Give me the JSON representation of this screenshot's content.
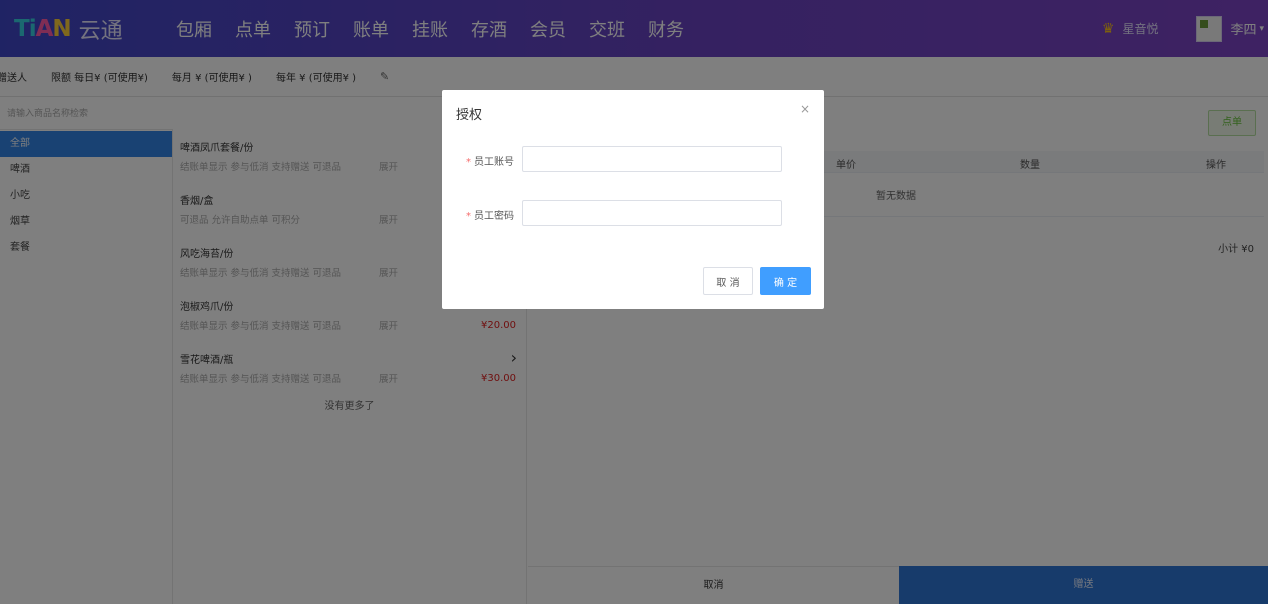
{
  "header": {
    "logo_mark": {
      "t": "T",
      "i": "i",
      "a": "A",
      "n": "N"
    },
    "logo_text": "云通",
    "nav": [
      "包厢",
      "点单",
      "预订",
      "账单",
      "挂账",
      "存酒",
      "会员",
      "交班",
      "财务"
    ],
    "store_name": "星音悦",
    "user_name": "李四"
  },
  "infobar": {
    "gift_person": "赠送人",
    "daily_limit": "限额 每日¥ (可使用¥)",
    "monthly_limit": "每月 ¥ (可使用¥ )",
    "yearly_limit": "每年 ¥ (可使用¥ )"
  },
  "search": {
    "placeholder": "请输入商品名称检索"
  },
  "categories": [
    "全部",
    "啤酒",
    "小吃",
    "烟草",
    "套餐"
  ],
  "products": [
    {
      "name": "啤酒凤爪套餐/份",
      "tags": "结账单显示 参与低消 支持赠送 可退品",
      "expand": "展开",
      "price": ""
    },
    {
      "name": "香烟/盒",
      "tags": "可退品 允许自助点单 可积分",
      "expand": "展开",
      "price": ""
    },
    {
      "name": "风吃海苔/份",
      "tags": "结账单显示 参与低消 支持赠送 可退品",
      "expand": "展开",
      "price": ""
    },
    {
      "name": "泡椒鸡爪/份",
      "tags": "结账单显示 参与低消 支持赠送 可退品",
      "expand": "展开",
      "price": "¥20.00"
    },
    {
      "name": "雪花啤酒/瓶",
      "tags": "结账单显示 参与低消 支持赠送 可退品",
      "expand": "展开",
      "price": "¥30.00"
    }
  ],
  "no_more": "没有更多了",
  "order": {
    "order_button": "点单",
    "columns": {
      "price": "单价",
      "quantity": "数量",
      "action": "操作"
    },
    "empty": "暂无数据",
    "subtotal": "小计 ¥0",
    "cancel": "取消",
    "gift": "赠送"
  },
  "modal": {
    "title": "授权",
    "close": "×",
    "account_label": "员工账号",
    "password_label": "员工密码",
    "required_mark": "*",
    "cancel": "取 消",
    "confirm": "确 定"
  },
  "colors": {
    "header_start": "#3f47c8",
    "header_end": "#7d45c6",
    "active_category": "#3385e6",
    "primary_button": "#409eff",
    "gift_button": "#2f76d6",
    "price": "#e02020"
  }
}
